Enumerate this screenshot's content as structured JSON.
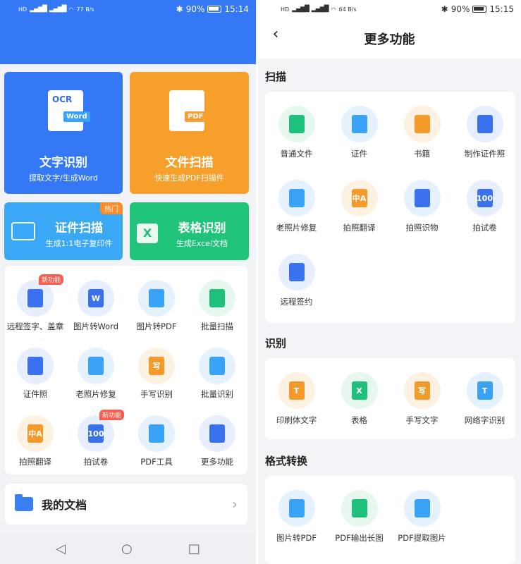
{
  "left": {
    "status": {
      "net_speed": "77 B/s",
      "battery": "90%",
      "time": "15:14"
    },
    "tiles": [
      {
        "title": "文字识别",
        "subtitle": "提取文字/生成Word",
        "icon_text_1": "OCR",
        "icon_text_2": "Word",
        "color": "#3478f6"
      },
      {
        "title": "文件扫描",
        "subtitle": "快速生成PDF扫描件",
        "icon_text": "PDF",
        "color": "#f6a02b"
      },
      {
        "title": "证件扫描",
        "subtitle": "生成1:1电子复印件",
        "badge": "热门",
        "color": "#3aa8f5"
      },
      {
        "title": "表格识别",
        "subtitle": "生成Excel文档",
        "icon_text": "X",
        "color": "#1fc47a"
      }
    ],
    "tools": [
      {
        "label": "远程签字、盖章",
        "icon": "pen-icon",
        "badge": "新功能"
      },
      {
        "label": "图片转Word",
        "icon": "word-doc-icon",
        "glyph": "W"
      },
      {
        "label": "图片转PDF",
        "icon": "image-pdf-icon"
      },
      {
        "label": "批量扫描",
        "icon": "batch-scan-icon"
      },
      {
        "label": "证件照",
        "icon": "id-photo-icon"
      },
      {
        "label": "老照片修复",
        "icon": "old-photo-icon"
      },
      {
        "label": "手写识别",
        "icon": "handwriting-icon",
        "glyph": "写"
      },
      {
        "label": "批量识别",
        "icon": "batch-recognize-icon"
      },
      {
        "label": "拍照翻译",
        "icon": "translate-icon",
        "glyph": "中A"
      },
      {
        "label": "拍试卷",
        "icon": "exam-paper-icon",
        "glyph": "100",
        "badge": "新功能"
      },
      {
        "label": "PDF工具",
        "icon": "toolbox-icon"
      },
      {
        "label": "更多功能",
        "icon": "grid-icon"
      }
    ],
    "my_docs": "我的文档"
  },
  "right": {
    "status": {
      "net_speed": "64 B/s",
      "battery": "90%",
      "time": "15:15"
    },
    "title": "更多功能",
    "sections": [
      {
        "title": "扫描",
        "items": [
          {
            "label": "普通文件",
            "icon": "document-icon",
            "bg": "#e6f7ee",
            "fg": "#1fbf7c"
          },
          {
            "label": "证件",
            "icon": "id-card-icon",
            "bg": "#e5f2fd",
            "fg": "#3aa2f5"
          },
          {
            "label": "书籍",
            "icon": "book-icon",
            "bg": "#fdf1e2",
            "fg": "#f39a2b"
          },
          {
            "label": "制作证件照",
            "icon": "id-photo-icon",
            "bg": "#e7eefd",
            "fg": "#3a72ee"
          },
          {
            "label": "老照片修复",
            "icon": "old-photo-icon",
            "bg": "#e5f2fd",
            "fg": "#3aa2f5"
          },
          {
            "label": "拍照翻译",
            "icon": "translate-icon",
            "bg": "#fdf1e2",
            "fg": "#f39a2b",
            "glyph": "中A"
          },
          {
            "label": "拍照识物",
            "icon": "object-scan-icon",
            "bg": "#e5f2fd",
            "fg": "#3a72ee"
          },
          {
            "label": "拍试卷",
            "icon": "exam-paper-icon",
            "bg": "#e7eefd",
            "fg": "#3a72ee",
            "glyph": "100"
          },
          {
            "label": "远程签约",
            "icon": "pen-icon",
            "bg": "#e7eefd",
            "fg": "#3a72ee"
          }
        ]
      },
      {
        "title": "识别",
        "items": [
          {
            "label": "印刷体文字",
            "icon": "text-t-icon",
            "bg": "#fdf1e2",
            "fg": "#f39a2b",
            "glyph": "T"
          },
          {
            "label": "表格",
            "icon": "excel-icon",
            "bg": "#e6f7ee",
            "fg": "#1fbf7c",
            "glyph": "X"
          },
          {
            "label": "手写文字",
            "icon": "handwriting-icon",
            "bg": "#fdf1e2",
            "fg": "#f39a2b",
            "glyph": "写"
          },
          {
            "label": "网络字识别",
            "icon": "web-text-icon",
            "bg": "#e5f2fd",
            "fg": "#3aa2f5",
            "glyph": "T"
          }
        ]
      },
      {
        "title": "格式转换",
        "items": [
          {
            "label": "图片转PDF",
            "icon": "image-pdf-icon",
            "bg": "#e5f2fd",
            "fg": "#3aa2f5"
          },
          {
            "label": "PDF输出长图",
            "icon": "pdf-long-image-icon",
            "bg": "#e6f7ee",
            "fg": "#1fbf7c"
          },
          {
            "label": "PDF提取图片",
            "icon": "pdf-extract-icon",
            "bg": "#e5f2fd",
            "fg": "#3aa2f5"
          }
        ]
      }
    ]
  }
}
